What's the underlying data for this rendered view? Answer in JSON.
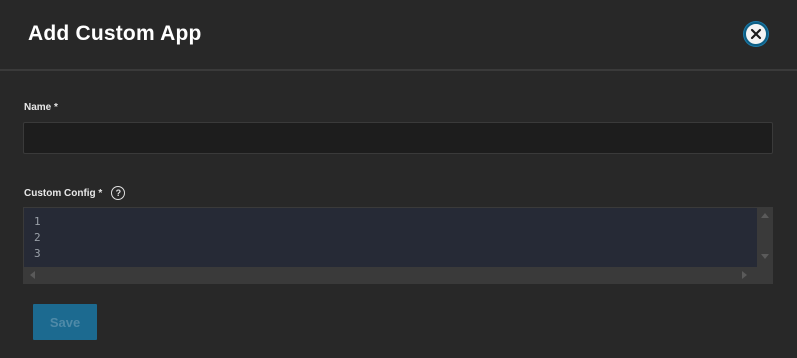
{
  "dialog": {
    "title": "Add Custom App",
    "close_icon": "close-icon"
  },
  "form": {
    "name": {
      "label": "Name *",
      "value": "",
      "placeholder": ""
    },
    "custom_config": {
      "label": "Custom Config *",
      "help_icon": "help-icon",
      "help_glyph": "?",
      "lines": [
        "1",
        "2",
        "3"
      ]
    },
    "save_label": "Save"
  },
  "colors": {
    "accent": "#1c6a90",
    "background": "#282828"
  }
}
